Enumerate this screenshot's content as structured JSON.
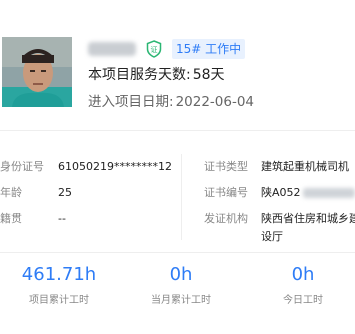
{
  "header": {
    "status_badge": "15# 工作中",
    "service_days_label": "本项目服务天数:",
    "service_days_value": "58天",
    "entry_date_label": "进入项目日期:",
    "entry_date_value": "2022-06-04",
    "cert_icon": "shield-check-icon"
  },
  "info": {
    "id_label": "身份证号",
    "id_value": "61050219********12",
    "age_label": "年龄",
    "age_value": "25",
    "origin_label": "籍贯",
    "origin_value": "--",
    "cert_type_label": "证书类型",
    "cert_type_value": "建筑起重机械司机",
    "cert_no_label": "证书编号",
    "cert_no_value": "陕A052",
    "issuer_label": "发证机构",
    "issuer_value_line1": "陕西省住房和城乡建",
    "issuer_value_line2": "设厅"
  },
  "stats": [
    {
      "value": "461.71h",
      "label": "项目累计工时"
    },
    {
      "value": "0h",
      "label": "当月累计工时"
    },
    {
      "value": "0h",
      "label": "今日工时"
    }
  ],
  "colors": {
    "accent": "#2e7cf6",
    "badge_bg": "#e8f1fe",
    "cert_green": "#2bb673"
  }
}
